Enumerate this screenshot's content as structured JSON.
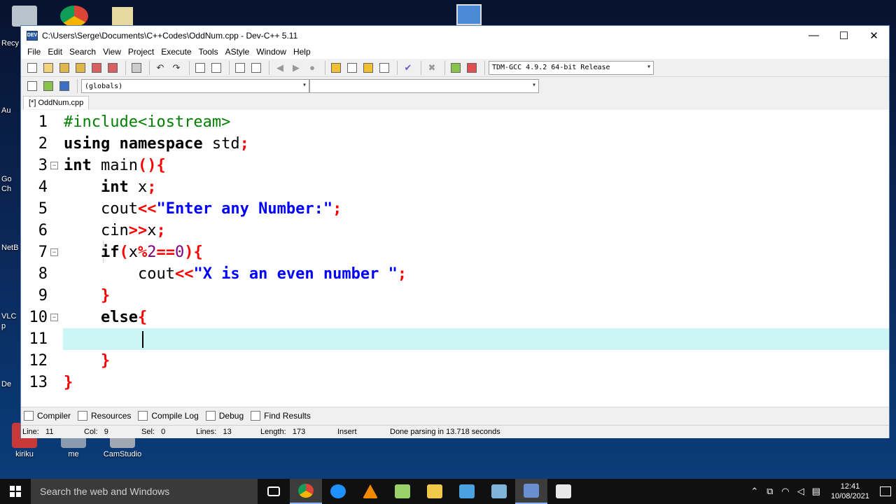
{
  "desktop": {
    "icons_bottom": [
      {
        "label": "kiriku"
      },
      {
        "label": "me"
      },
      {
        "label": "CamStudio"
      }
    ],
    "left_labels": [
      "Recy",
      "Au",
      "Go",
      "Ch",
      "NetB",
      "VLC",
      "p",
      "De"
    ]
  },
  "window": {
    "title": "C:\\Users\\Serge\\Documents\\C++Codes\\OddNum.cpp - Dev-C++ 5.11",
    "app_icon_text": "DEV",
    "controls": {
      "minimize": "—",
      "maximize": "☐",
      "close": "✕"
    },
    "menu": [
      "File",
      "Edit",
      "Search",
      "View",
      "Project",
      "Execute",
      "Tools",
      "AStyle",
      "Window",
      "Help"
    ],
    "compiler_select": "TDM-GCC 4.9.2 64-bit Release",
    "scope_select": "(globals)",
    "member_select": "",
    "file_tab": "[*] OddNum.cpp"
  },
  "editor": {
    "line_numbers": [
      "1",
      "2",
      "3",
      "4",
      "5",
      "6",
      "7",
      "8",
      "9",
      "10",
      "11",
      "12",
      "13"
    ],
    "lines": [
      [
        {
          "c": "pp",
          "t": "#include<iostream>"
        }
      ],
      [
        {
          "c": "kw",
          "t": "using namespace "
        },
        {
          "c": "txt",
          "t": "std"
        },
        {
          "c": "sym",
          "t": ";"
        }
      ],
      [
        {
          "c": "kw",
          "t": "int "
        },
        {
          "c": "txt",
          "t": "main"
        },
        {
          "c": "sym",
          "t": "(){"
        }
      ],
      [
        {
          "c": "txt",
          "t": "    "
        },
        {
          "c": "kw",
          "t": "int "
        },
        {
          "c": "txt",
          "t": "x"
        },
        {
          "c": "sym",
          "t": ";"
        }
      ],
      [
        {
          "c": "txt",
          "t": "    cout"
        },
        {
          "c": "sym",
          "t": "<<"
        },
        {
          "c": "str",
          "t": "\"Enter any Number:\""
        },
        {
          "c": "sym",
          "t": ";"
        }
      ],
      [
        {
          "c": "txt",
          "t": "    cin"
        },
        {
          "c": "sym",
          "t": ">>"
        },
        {
          "c": "txt",
          "t": "x"
        },
        {
          "c": "sym",
          "t": ";"
        }
      ],
      [
        {
          "c": "txt",
          "t": "    "
        },
        {
          "c": "kw",
          "t": "if"
        },
        {
          "c": "sym",
          "t": "("
        },
        {
          "c": "txt",
          "t": "x"
        },
        {
          "c": "sym",
          "t": "%"
        },
        {
          "c": "num",
          "t": "2"
        },
        {
          "c": "sym",
          "t": "=="
        },
        {
          "c": "num",
          "t": "0"
        },
        {
          "c": "sym",
          "t": "){"
        }
      ],
      [
        {
          "c": "txt",
          "t": "        cout"
        },
        {
          "c": "sym",
          "t": "<<"
        },
        {
          "c": "str",
          "t": "\"X is an even number \""
        },
        {
          "c": "sym",
          "t": ";"
        }
      ],
      [
        {
          "c": "txt",
          "t": "    "
        },
        {
          "c": "sym",
          "t": "}"
        }
      ],
      [
        {
          "c": "txt",
          "t": "    "
        },
        {
          "c": "kw",
          "t": "else"
        },
        {
          "c": "sym",
          "t": "{"
        }
      ],
      [
        {
          "c": "txt",
          "t": ""
        }
      ],
      [
        {
          "c": "txt",
          "t": "    "
        },
        {
          "c": "sym",
          "t": "}"
        }
      ],
      [
        {
          "c": "sym",
          "t": "}"
        }
      ]
    ],
    "fold_markers_on_lines": [
      3,
      7,
      10
    ],
    "current_line": 11
  },
  "bottom_tabs": [
    "Compiler",
    "Resources",
    "Compile Log",
    "Debug",
    "Find Results"
  ],
  "status": {
    "line": "Line:   11",
    "col": "Col:   9",
    "sel": "Sel:   0",
    "lines": "Lines:   13",
    "length": "Length:   173",
    "mode": "Insert",
    "message": "Done parsing in 13.718 seconds"
  },
  "taskbar": {
    "search_placeholder": "Search the web and Windows",
    "time": "12:41",
    "date": "10/08/2021"
  },
  "colors": {
    "current_line": "#ccf6f6",
    "keyword": "#000000",
    "preprocessor": "#008000",
    "string": "#0000ff",
    "symbol": "#ff0000",
    "number": "#800080"
  }
}
